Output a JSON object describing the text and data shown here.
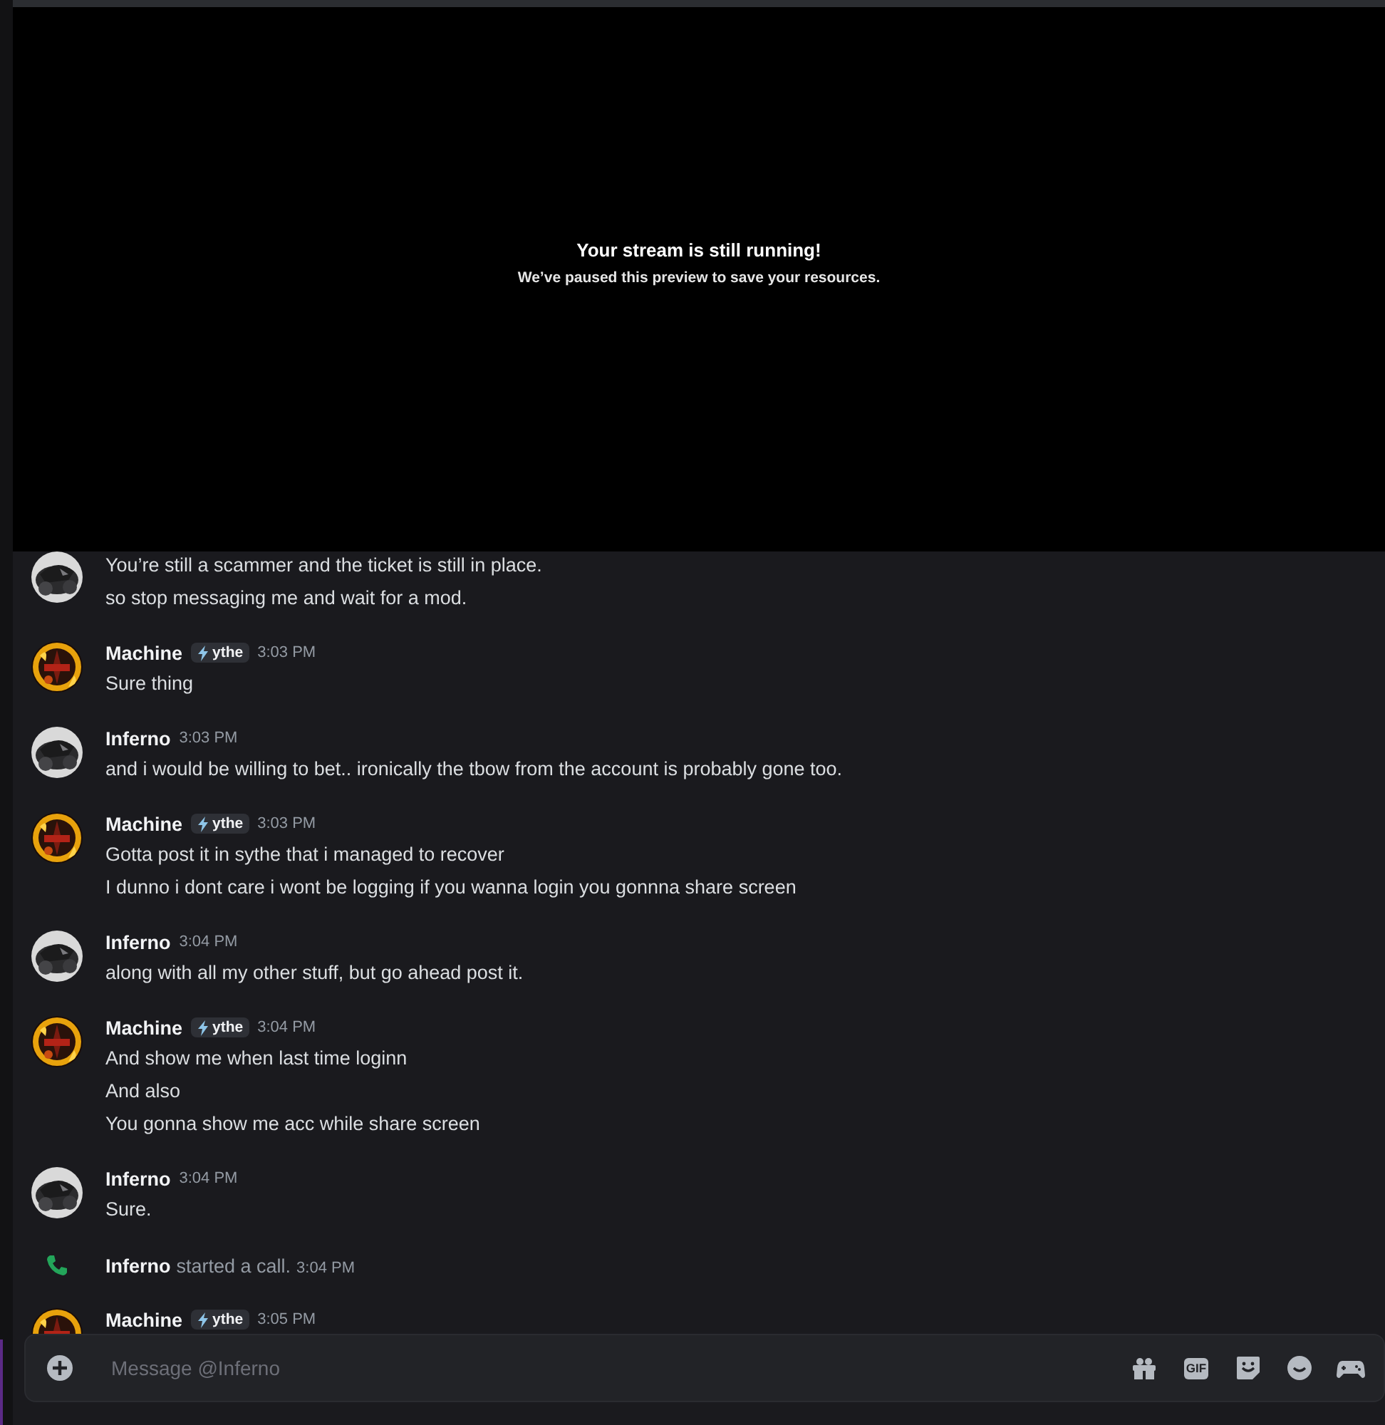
{
  "stream_notice": {
    "title": "Your stream is still running!",
    "subtitle": "We’ve paused this preview to save your resources."
  },
  "messages": [
    {
      "kind": "message",
      "lines": [
        "You’re still a scammer and the ticket is still in place.",
        "so stop messaging me and wait for a mod."
      ]
    },
    {
      "kind": "message",
      "author": "Machine",
      "badge": {
        "text": "ythe"
      },
      "time": "3:03 PM",
      "lines": [
        "Sure thing"
      ]
    },
    {
      "kind": "message",
      "author": "Inferno",
      "time": "3:03 PM",
      "lines": [
        "and i would be willing to bet.. ironically the tbow from the account is probably gone too."
      ]
    },
    {
      "kind": "message",
      "author": "Machine",
      "badge": {
        "text": "ythe"
      },
      "time": "3:03 PM",
      "lines": [
        "Gotta post it in sythe that i managed to recover",
        "I dunno i dont care i wont be logging if you wanna login you gonnna share screen"
      ]
    },
    {
      "kind": "message",
      "author": "Inferno",
      "time": "3:04 PM",
      "lines": [
        "along with all my other stuff, but go ahead post it."
      ]
    },
    {
      "kind": "message",
      "author": "Machine",
      "badge": {
        "text": "ythe"
      },
      "time": "3:04 PM",
      "lines": [
        "And show me when last time loginn",
        "And also",
        "You gonna show me acc while share screen"
      ]
    },
    {
      "kind": "message",
      "author": "Inferno",
      "time": "3:04 PM",
      "lines": [
        "Sure."
      ]
    },
    {
      "kind": "call",
      "author": "Inferno",
      "text": "started a call.",
      "time": "3:04 PM"
    },
    {
      "kind": "message",
      "author": "Machine",
      "badge": {
        "text": "ythe"
      },
      "time": "3:05 PM"
    }
  ],
  "composer": {
    "placeholder": "Message @Inferno",
    "gif_label": "GIF"
  }
}
